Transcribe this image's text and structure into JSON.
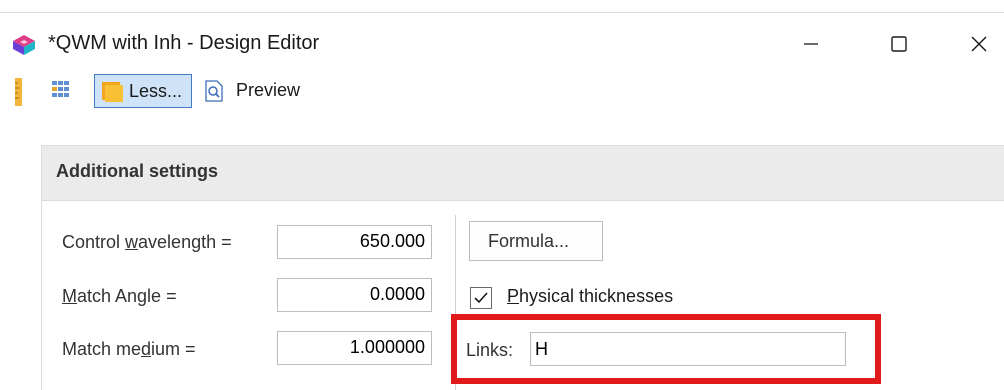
{
  "window": {
    "title": "*QWM with Inh - Design Editor"
  },
  "toolbar": {
    "less_label": "Less...",
    "preview_label": "Preview"
  },
  "panel": {
    "header": "Additional settings",
    "fields": [
      {
        "label_pre": "Control ",
        "label_acc": "w",
        "label_post": "avelength =",
        "value": "650.000"
      },
      {
        "label_pre": "",
        "label_acc": "M",
        "label_post": "atch Angle =",
        "value": "0.0000"
      },
      {
        "label_pre": "Match me",
        "label_acc": "d",
        "label_post": "ium =",
        "value": "1.000000"
      }
    ],
    "formula_label": "Formula...",
    "physical": {
      "checked": true,
      "label_acc": "P",
      "label_post": "hysical thicknesses"
    },
    "links": {
      "label": "Links:",
      "value": "H"
    }
  },
  "colors": {
    "highlight": "#e01a1a",
    "less_button_bg": "#cfe3f8",
    "header_bg": "#ebebeb"
  },
  "icons": [
    "app-logo-icon",
    "minimize-icon",
    "maximize-icon",
    "close-icon",
    "ruler-icon",
    "grid-icon",
    "folder-icon",
    "preview-icon",
    "checkmark-icon"
  ]
}
